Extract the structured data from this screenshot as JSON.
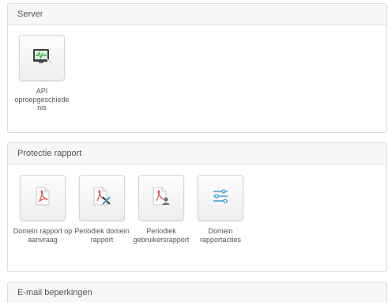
{
  "sections": [
    {
      "title": "Server",
      "tiles": [
        {
          "label": "API oproepgeschiedenis",
          "icon": "server-monitor-icon"
        }
      ]
    },
    {
      "title": "Protectie rapport",
      "tiles": [
        {
          "label": "Domein rapport op aanvraag",
          "icon": "pdf-icon"
        },
        {
          "label": "Periodiek domein rapport",
          "icon": "pdf-edit-icon"
        },
        {
          "label": "Periodiek gebruikersrapport",
          "icon": "pdf-user-icon"
        },
        {
          "label": "Domein rapportacties",
          "icon": "sliders-icon"
        }
      ]
    },
    {
      "title": "E-mail beperkingen",
      "tiles": []
    }
  ],
  "colors": {
    "pdf_red": "#d9534f",
    "monitor_green": "#4caf50",
    "slider_blue": "#3aa0d8"
  }
}
